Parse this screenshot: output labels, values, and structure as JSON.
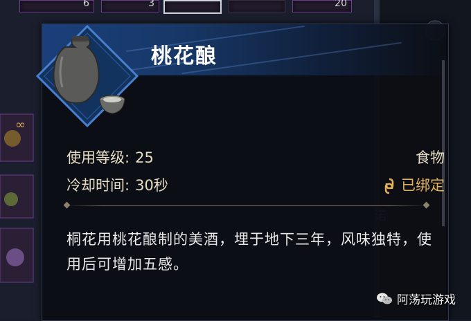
{
  "inventory": {
    "top_counts": [
      "6",
      "3",
      "20"
    ]
  },
  "item": {
    "name": "桃花酿",
    "icon": "wine-jar-and-cup-icon",
    "level_label": "使用等级:",
    "level_value": "25",
    "category": "食物",
    "cooldown_label": "冷却时间:",
    "cooldown_value": "30秒",
    "bound_status": "已绑定",
    "bound_icon": "bind-chain-icon",
    "description": "桐花用桃花酿制的美酒，埋于地下三年，风味独特，使用后可增加五感。"
  },
  "watermark": {
    "text": "阿荡玩游戏",
    "logo": "wechat-icon"
  },
  "colors": {
    "header_blue": "#1a3f7a",
    "bound_gold": "#e3b15a",
    "stat_text": "#e6dcc4"
  }
}
